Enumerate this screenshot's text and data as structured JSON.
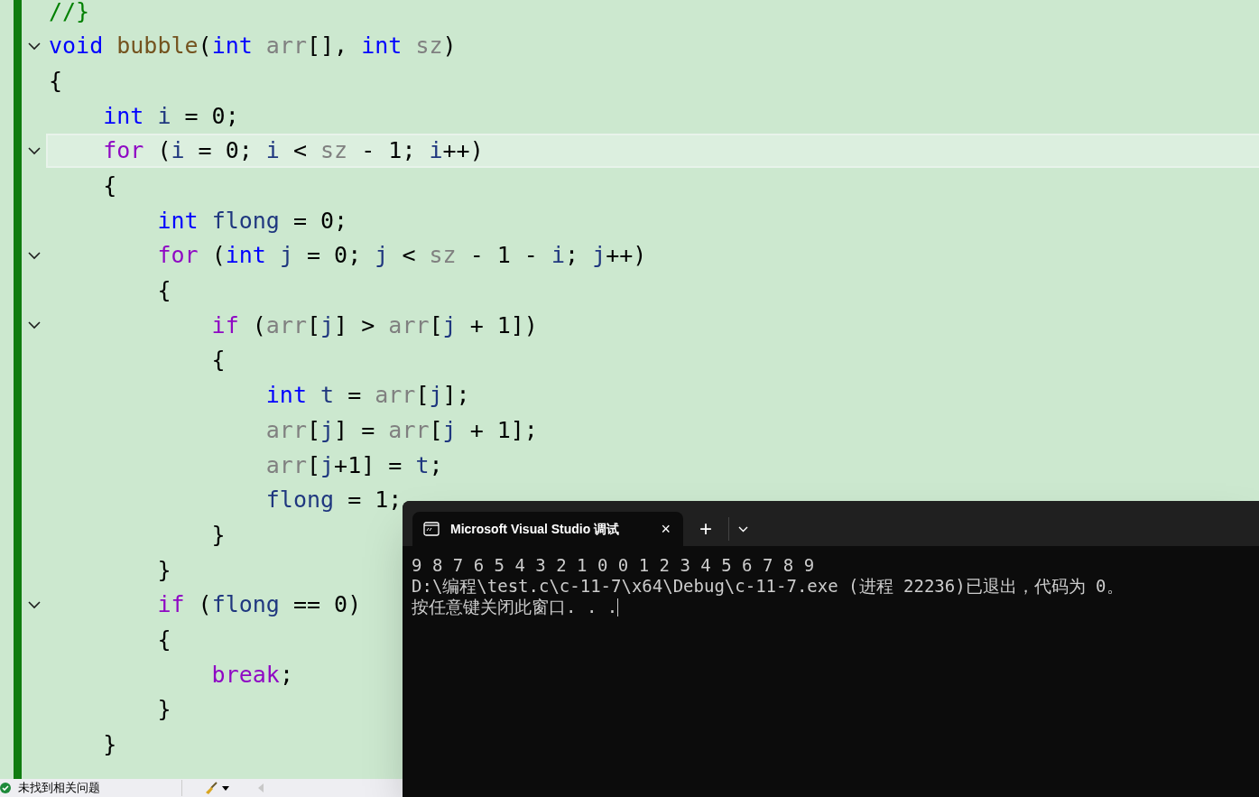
{
  "editor": {
    "lines": [
      {
        "fold": false,
        "current": false,
        "tokens": [
          {
            "kind": "comment",
            "text": "//}"
          }
        ]
      },
      {
        "fold": true,
        "current": false,
        "tokens": [
          {
            "kind": "kw",
            "text": "void"
          },
          {
            "kind": "fn",
            "text": " bubble"
          },
          {
            "kind": "plain",
            "text": "("
          },
          {
            "kind": "kw",
            "text": "int"
          },
          {
            "kind": "param",
            "text": " arr"
          },
          {
            "kind": "plain",
            "text": "[], "
          },
          {
            "kind": "kw",
            "text": "int"
          },
          {
            "kind": "param",
            "text": " sz"
          },
          {
            "kind": "plain",
            "text": ")"
          }
        ]
      },
      {
        "fold": false,
        "current": false,
        "tokens": [
          {
            "kind": "plain",
            "text": "{"
          }
        ]
      },
      {
        "fold": false,
        "current": false,
        "tokens": [
          {
            "kind": "kw",
            "text": "    int"
          },
          {
            "kind": "local",
            "text": " i"
          },
          {
            "kind": "plain",
            "text": " = 0;"
          }
        ]
      },
      {
        "fold": true,
        "current": true,
        "tokens": [
          {
            "kind": "ctl",
            "text": "    for"
          },
          {
            "kind": "plain",
            "text": " ("
          },
          {
            "kind": "local",
            "text": "i"
          },
          {
            "kind": "plain",
            "text": " = 0; "
          },
          {
            "kind": "local",
            "text": "i"
          },
          {
            "kind": "plain",
            "text": " < "
          },
          {
            "kind": "param",
            "text": "sz"
          },
          {
            "kind": "plain",
            "text": " - 1; "
          },
          {
            "kind": "local",
            "text": "i"
          },
          {
            "kind": "plain",
            "text": "++)"
          }
        ]
      },
      {
        "fold": false,
        "current": false,
        "tokens": [
          {
            "kind": "plain",
            "text": "    {"
          }
        ]
      },
      {
        "fold": false,
        "current": false,
        "tokens": [
          {
            "kind": "kw",
            "text": "        int"
          },
          {
            "kind": "local",
            "text": " flong"
          },
          {
            "kind": "plain",
            "text": " = 0;"
          }
        ]
      },
      {
        "fold": true,
        "current": false,
        "tokens": [
          {
            "kind": "ctl",
            "text": "        for"
          },
          {
            "kind": "plain",
            "text": " ("
          },
          {
            "kind": "kw",
            "text": "int"
          },
          {
            "kind": "local",
            "text": " j"
          },
          {
            "kind": "plain",
            "text": " = 0; "
          },
          {
            "kind": "local",
            "text": "j"
          },
          {
            "kind": "plain",
            "text": " < "
          },
          {
            "kind": "param",
            "text": "sz"
          },
          {
            "kind": "plain",
            "text": " - 1 - "
          },
          {
            "kind": "local",
            "text": "i"
          },
          {
            "kind": "plain",
            "text": "; "
          },
          {
            "kind": "local",
            "text": "j"
          },
          {
            "kind": "plain",
            "text": "++)"
          }
        ]
      },
      {
        "fold": false,
        "current": false,
        "tokens": [
          {
            "kind": "plain",
            "text": "        {"
          }
        ]
      },
      {
        "fold": true,
        "current": false,
        "tokens": [
          {
            "kind": "ctl",
            "text": "            if"
          },
          {
            "kind": "plain",
            "text": " ("
          },
          {
            "kind": "param",
            "text": "arr"
          },
          {
            "kind": "plain",
            "text": "["
          },
          {
            "kind": "local",
            "text": "j"
          },
          {
            "kind": "plain",
            "text": "] > "
          },
          {
            "kind": "param",
            "text": "arr"
          },
          {
            "kind": "plain",
            "text": "["
          },
          {
            "kind": "local",
            "text": "j"
          },
          {
            "kind": "plain",
            "text": " + 1])"
          }
        ]
      },
      {
        "fold": false,
        "current": false,
        "tokens": [
          {
            "kind": "plain",
            "text": "            {"
          }
        ]
      },
      {
        "fold": false,
        "current": false,
        "tokens": [
          {
            "kind": "kw",
            "text": "                int"
          },
          {
            "kind": "local",
            "text": " t"
          },
          {
            "kind": "plain",
            "text": " = "
          },
          {
            "kind": "param",
            "text": "arr"
          },
          {
            "kind": "plain",
            "text": "["
          },
          {
            "kind": "local",
            "text": "j"
          },
          {
            "kind": "plain",
            "text": "];"
          }
        ]
      },
      {
        "fold": false,
        "current": false,
        "tokens": [
          {
            "kind": "param",
            "text": "                arr"
          },
          {
            "kind": "plain",
            "text": "["
          },
          {
            "kind": "local",
            "text": "j"
          },
          {
            "kind": "plain",
            "text": "] = "
          },
          {
            "kind": "param",
            "text": "arr"
          },
          {
            "kind": "plain",
            "text": "["
          },
          {
            "kind": "local",
            "text": "j"
          },
          {
            "kind": "plain",
            "text": " + 1];"
          }
        ]
      },
      {
        "fold": false,
        "current": false,
        "tokens": [
          {
            "kind": "param",
            "text": "                arr"
          },
          {
            "kind": "plain",
            "text": "["
          },
          {
            "kind": "local",
            "text": "j"
          },
          {
            "kind": "plain",
            "text": "+1] = "
          },
          {
            "kind": "local",
            "text": "t"
          },
          {
            "kind": "plain",
            "text": ";"
          }
        ]
      },
      {
        "fold": false,
        "current": false,
        "tokens": [
          {
            "kind": "local",
            "text": "                flong"
          },
          {
            "kind": "plain",
            "text": " = 1;"
          }
        ]
      },
      {
        "fold": false,
        "current": false,
        "tokens": [
          {
            "kind": "plain",
            "text": "            }"
          }
        ]
      },
      {
        "fold": false,
        "current": false,
        "tokens": [
          {
            "kind": "plain",
            "text": "        }"
          }
        ]
      },
      {
        "fold": true,
        "current": false,
        "tokens": [
          {
            "kind": "ctl",
            "text": "        if"
          },
          {
            "kind": "plain",
            "text": " ("
          },
          {
            "kind": "local",
            "text": "flong"
          },
          {
            "kind": "plain",
            "text": " == 0)"
          }
        ]
      },
      {
        "fold": false,
        "current": false,
        "tokens": [
          {
            "kind": "plain",
            "text": "        {"
          }
        ]
      },
      {
        "fold": false,
        "current": false,
        "tokens": [
          {
            "kind": "ctl",
            "text": "            break"
          },
          {
            "kind": "plain",
            "text": ";"
          }
        ]
      },
      {
        "fold": false,
        "current": false,
        "tokens": [
          {
            "kind": "plain",
            "text": "        }"
          }
        ]
      },
      {
        "fold": false,
        "current": false,
        "tokens": [
          {
            "kind": "plain",
            "text": "    }"
          }
        ]
      }
    ]
  },
  "status_bar": {
    "message": "未找到相关问题"
  },
  "terminal": {
    "tab_title": "Microsoft Visual Studio 调试",
    "close": "×",
    "new_tab": "+",
    "output": [
      "9 8 7 6 5 4 3 2 1 0 0 1 2 3 4 5 6 7 8 9",
      "D:\\编程\\test.c\\c-11-7\\x64\\Debug\\c-11-7.exe (进程 22236)已退出，代码为 0。",
      "按任意键关闭此窗口. . ."
    ]
  }
}
